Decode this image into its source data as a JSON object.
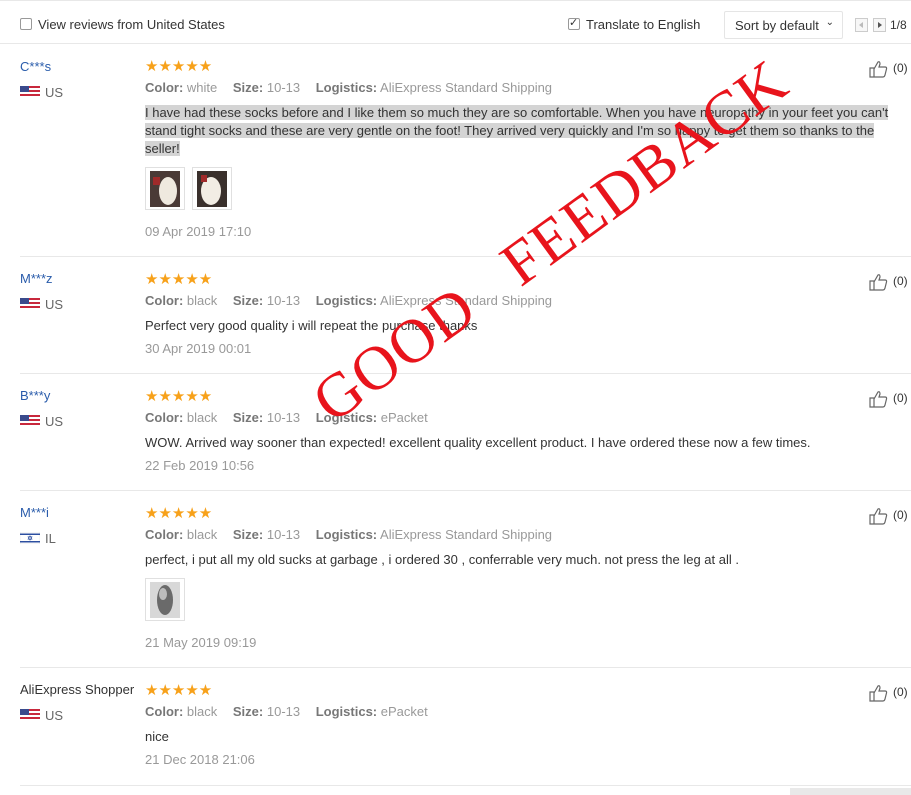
{
  "toolbar": {
    "view_reviews_label": "View reviews from United States",
    "view_reviews_checked": false,
    "translate_label": "Translate to English",
    "translate_checked": true,
    "sort_label": "Sort by default",
    "pager": "1/8"
  },
  "reviews": [
    {
      "user": "C***s",
      "country": "US",
      "rating": 5,
      "stars": "★★★★★",
      "color_label": "Color:",
      "color": "white",
      "size_label": "Size:",
      "size": "10-13",
      "logistics_label": "Logistics:",
      "logistics": "AliExpress Standard Shipping",
      "text": "I have had these socks before and I like them so much they are so comfortable. When you have neuropathy in your feet you can't stand tight socks and these are very gentle on the foot! They arrived very quickly and I'm so happy to get them so thanks to the seller!",
      "date": "09 Apr 2019 17:10",
      "likes": "(0)"
    },
    {
      "user": "M***z",
      "country": "US",
      "rating": 5,
      "stars": "★★★★★",
      "color_label": "Color:",
      "color": "black",
      "size_label": "Size:",
      "size": "10-13",
      "logistics_label": "Logistics:",
      "logistics": "AliExpress Standard Shipping",
      "text": "Perfect very good quality i will repeat the purchase thanks",
      "date": "30 Apr 2019 00:01",
      "likes": "(0)"
    },
    {
      "user": "B***y",
      "country": "US",
      "rating": 5,
      "stars": "★★★★★",
      "color_label": "Color:",
      "color": "black",
      "size_label": "Size:",
      "size": "10-13",
      "logistics_label": "Logistics:",
      "logistics": "ePacket",
      "text": "WOW. Arrived way sooner than expected! excellent quality excellent product. I have ordered these now a few times.",
      "date": "22 Feb 2019 10:56",
      "likes": "(0)"
    },
    {
      "user": "M***i",
      "country": "IL",
      "rating": 5,
      "stars": "★★★★★",
      "color_label": "Color:",
      "color": "black",
      "size_label": "Size:",
      "size": "10-13",
      "logistics_label": "Logistics:",
      "logistics": "AliExpress Standard Shipping",
      "text": "perfect, i put all my old sucks at garbage , i ordered 30 , conferrable very much. not press the leg at all .",
      "date": "21 May 2019 09:19",
      "likes": "(0)"
    },
    {
      "user": "AliExpress Shopper",
      "country": "US",
      "rating": 5,
      "stars": "★★★★★",
      "color_label": "Color:",
      "color": "black",
      "size_label": "Size:",
      "size": "10-13",
      "logistics_label": "Logistics:",
      "logistics": "ePacket",
      "text": "nice",
      "date": "21 Dec 2018 21:06",
      "likes": "(0)"
    }
  ],
  "overlay_text": "GOOD   FEEDBACK",
  "colors": {
    "link": "#2a5cab",
    "star": "#f7a11a",
    "stamp": "#e8141c",
    "muted": "#999999"
  }
}
